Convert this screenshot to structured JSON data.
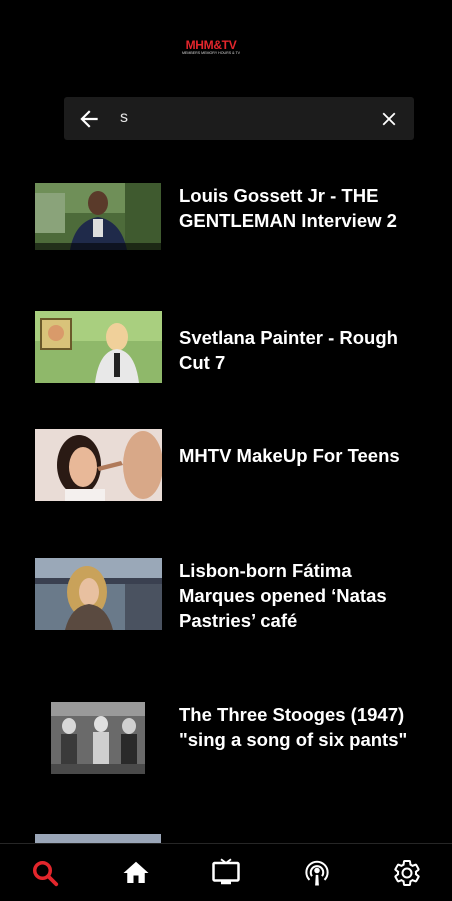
{
  "app": {
    "logo_text": "MHM&TV",
    "logo_subtext": "MEMBERS MEMORY HOURS & TV"
  },
  "search": {
    "query": "s",
    "back_icon": "arrow-left-icon",
    "clear_icon": "close-icon"
  },
  "results": [
    {
      "title": "Louis Gossett Jr - THE GENTLEMAN Interview 2",
      "thumb": "interview-man-outdoors"
    },
    {
      "title": "Svetlana Painter - Rough Cut 7",
      "thumb": "woman-with-painting"
    },
    {
      "title": "MHTV MakeUp For Teens",
      "thumb": "makeup-two-women"
    },
    {
      "title": "Lisbon-born Fátima Marques opened ‘Natas Pastries’ café",
      "thumb": "woman-in-cafe"
    },
    {
      "title": "The Three Stooges (1947) \"sing a song of six pants\"",
      "thumb": "black-white-film"
    }
  ],
  "bottom_nav": [
    {
      "name": "search",
      "icon": "search-icon",
      "active": true
    },
    {
      "name": "home",
      "icon": "home-icon",
      "active": false
    },
    {
      "name": "tv",
      "icon": "tv-icon",
      "active": false
    },
    {
      "name": "podcast",
      "icon": "podcast-icon",
      "active": false
    },
    {
      "name": "settings",
      "icon": "gear-icon",
      "active": false
    }
  ],
  "colors": {
    "accent": "#e3262c",
    "background": "#000000",
    "search_bg": "#1c1c1c",
    "icon_default": "#ffffff"
  }
}
